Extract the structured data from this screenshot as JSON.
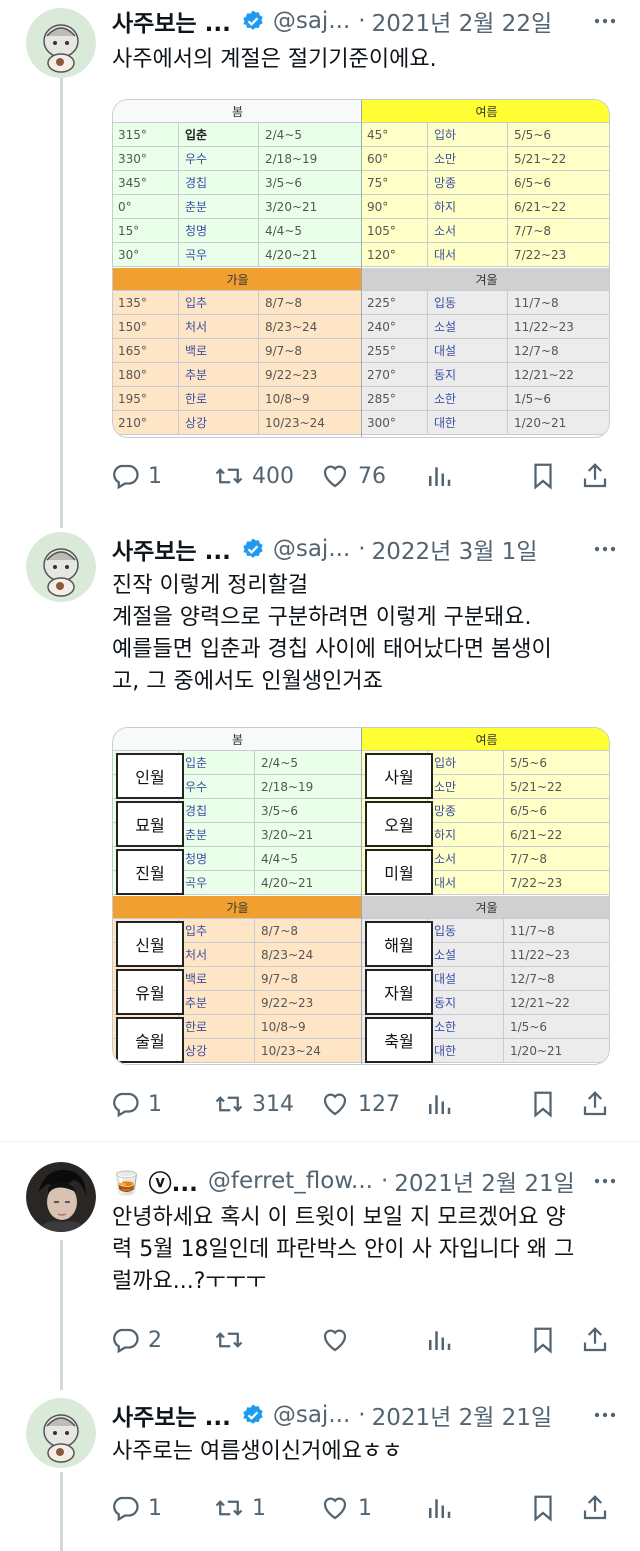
{
  "tweets": [
    {
      "name": "사주보는 ...",
      "handle": "@saj...",
      "sep": "·",
      "date": "2021년 2월 22일",
      "lines": [
        "사주에서의 계절은 절기기준이에요."
      ],
      "replies": "1",
      "retweets": "400",
      "likes": "76"
    },
    {
      "name": "사주보는 ...",
      "handle": "@saj...",
      "sep": "·",
      "date": "2022년 3월 1일",
      "lines": [
        "진작 이렇게 정리할걸",
        "계절을 양력으로 구분하려면 이렇게 구분돼요.",
        "예를들면 입춘과 경칩 사이에 태어났다면 봄생이",
        "고, 그 중에서도 인월생인거죠"
      ],
      "replies": "1",
      "retweets": "314",
      "likes": "127"
    },
    {
      "name": "🥃 ⓥ...",
      "handle": "@ferret_flow...",
      "sep": "·",
      "date": "2021년 2월 21일",
      "lines": [
        "안녕하세요 혹시 이 트윗이 보일 지 모르겠어요 양",
        "력 5월 18일인데 파란박스 안이 사 자입니다 왜 그",
        "럴까요...?ㅜㅜㅜ"
      ],
      "replies": "2",
      "retweets": "",
      "likes": ""
    },
    {
      "name": "사주보는 ...",
      "handle": "@saj...",
      "sep": "·",
      "date": "2021년 2월 21일",
      "lines": [
        "사주로는 여름생이신거에요ㅎㅎ"
      ],
      "replies": "1",
      "retweets": "1",
      "likes": "1"
    }
  ],
  "table1": {
    "spring": {
      "title": "봄",
      "color": "#eaffea",
      "head": "#f8f9fa",
      "rows": [
        [
          "315°",
          "입춘",
          "2/4~5"
        ],
        [
          "330°",
          "우수",
          "2/18~19"
        ],
        [
          "345°",
          "경칩",
          "3/5~6"
        ],
        [
          "0°",
          "춘분",
          "3/20~21"
        ],
        [
          "15°",
          "청명",
          "4/4~5"
        ],
        [
          "30°",
          "곡우",
          "4/20~21"
        ]
      ]
    },
    "summer": {
      "title": "여름",
      "color": "#ffffc8",
      "head": "#ffff33",
      "rows": [
        [
          "45°",
          "입하",
          "5/5~6"
        ],
        [
          "60°",
          "소만",
          "5/21~22"
        ],
        [
          "75°",
          "망종",
          "6/5~6"
        ],
        [
          "90°",
          "하지",
          "6/21~22"
        ],
        [
          "105°",
          "소서",
          "7/7~8"
        ],
        [
          "120°",
          "대서",
          "7/22~23"
        ]
      ]
    },
    "autumn": {
      "title": "가을",
      "color": "#fde5c6",
      "head": "#f0a030",
      "rows": [
        [
          "135°",
          "입추",
          "8/7~8"
        ],
        [
          "150°",
          "처서",
          "8/23~24"
        ],
        [
          "165°",
          "백로",
          "9/7~8"
        ],
        [
          "180°",
          "추분",
          "9/22~23"
        ],
        [
          "195°",
          "한로",
          "10/8~9"
        ],
        [
          "210°",
          "상강",
          "10/23~24"
        ]
      ]
    },
    "winter": {
      "title": "겨울",
      "color": "#ececec",
      "head": "#d0d0d0",
      "rows": [
        [
          "225°",
          "입동",
          "11/7~8"
        ],
        [
          "240°",
          "소설",
          "11/22~23"
        ],
        [
          "255°",
          "대설",
          "12/7~8"
        ],
        [
          "270°",
          "동지",
          "12/21~22"
        ],
        [
          "285°",
          "소한",
          "1/5~6"
        ],
        [
          "300°",
          "대한",
          "1/20~21"
        ]
      ]
    }
  },
  "table2": {
    "spring": {
      "title": "봄",
      "months": [
        "인월",
        "묘월",
        "진월"
      ],
      "rows": [
        [
          "입춘",
          "2/4~5"
        ],
        [
          "우수",
          "2/18~19"
        ],
        [
          "경칩",
          "3/5~6"
        ],
        [
          "춘분",
          "3/20~21"
        ],
        [
          "청명",
          "4/4~5"
        ],
        [
          "곡우",
          "4/20~21"
        ]
      ]
    },
    "summer": {
      "title": "여름",
      "months": [
        "사월",
        "오월",
        "미월"
      ],
      "rows": [
        [
          "입하",
          "5/5~6"
        ],
        [
          "소만",
          "5/21~22"
        ],
        [
          "망종",
          "6/5~6"
        ],
        [
          "하지",
          "6/21~22"
        ],
        [
          "소서",
          "7/7~8"
        ],
        [
          "대서",
          "7/22~23"
        ]
      ]
    },
    "autumn": {
      "title": "가을",
      "months": [
        "신월",
        "유월",
        "술월"
      ],
      "rows": [
        [
          "입추",
          "8/7~8"
        ],
        [
          "처서",
          "8/23~24"
        ],
        [
          "백로",
          "9/7~8"
        ],
        [
          "추분",
          "9/22~23"
        ],
        [
          "한로",
          "10/8~9"
        ],
        [
          "상강",
          "10/23~24"
        ]
      ]
    },
    "winter": {
      "title": "겨울",
      "months": [
        "해월",
        "자월",
        "축월"
      ],
      "rows": [
        [
          "입동",
          "11/7~8"
        ],
        [
          "소설",
          "11/22~23"
        ],
        [
          "대설",
          "12/7~8"
        ],
        [
          "동지",
          "12/21~22"
        ],
        [
          "소한",
          "1/5~6"
        ],
        [
          "대한",
          "1/20~21"
        ]
      ]
    }
  },
  "icons": {
    "reply": "reply-icon",
    "retweet": "retweet-icon",
    "like": "heart-icon",
    "views": "views-icon",
    "bookmark": "bookmark-icon",
    "share": "share-icon"
  },
  "colors": {
    "verified": "#1d9bf0",
    "muted": "#536471"
  }
}
